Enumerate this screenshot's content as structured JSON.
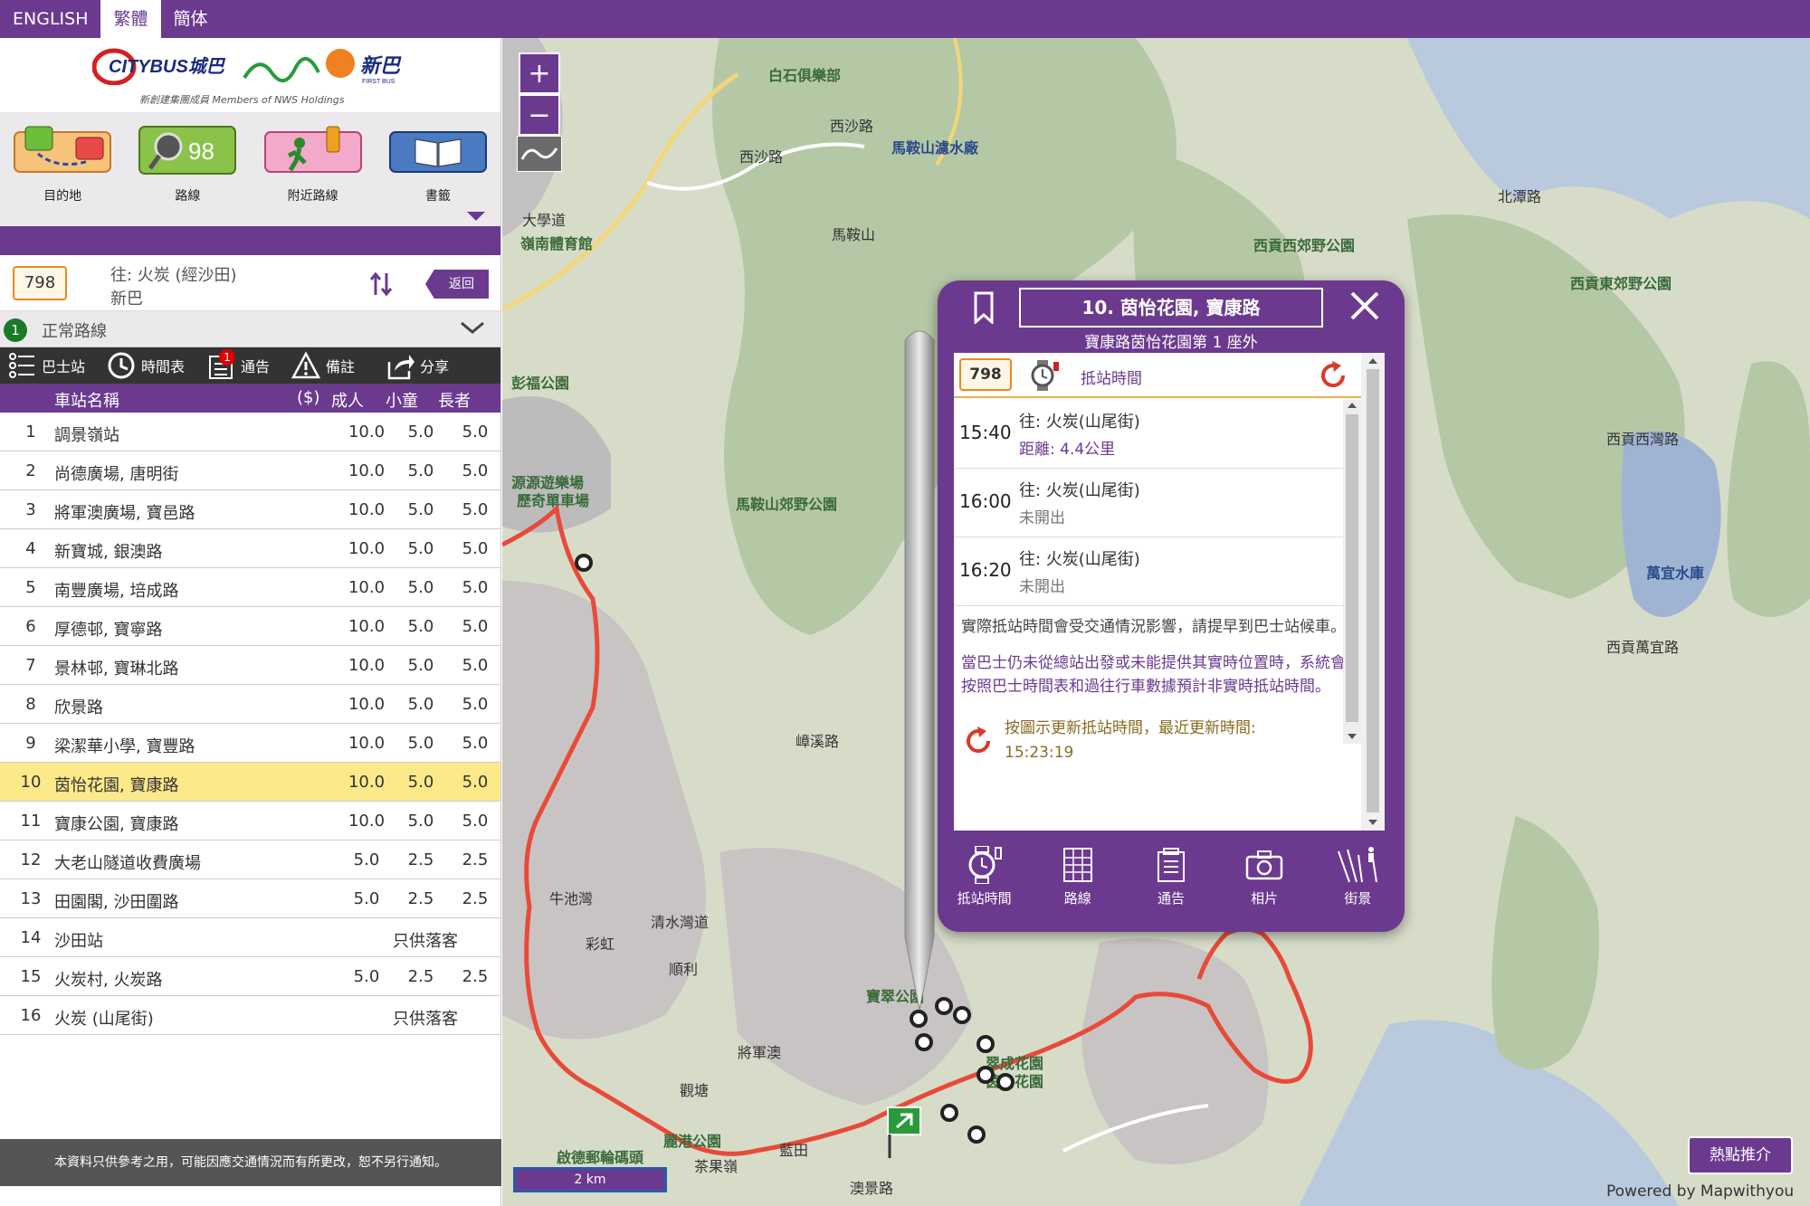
{
  "languages": [
    {
      "label": "ENGLISH",
      "active": false
    },
    {
      "label": "繁體",
      "active": true
    },
    {
      "label": "簡体",
      "active": false
    }
  ],
  "logo": {
    "citybus": "CITYBUS城巴",
    "nwfb": "新巴",
    "nwfb_sub": "FIRST BUS",
    "members": "新創建集團成員 Members of NWS Holdings"
  },
  "nav": [
    {
      "label": "目的地",
      "icon": "from-to-icon"
    },
    {
      "label": "路線",
      "icon": "route-search-icon",
      "icon_text": "98"
    },
    {
      "label": "附近路線",
      "icon": "nearby-walker-icon"
    },
    {
      "label": "書籤",
      "icon": "bookmark-book-icon"
    }
  ],
  "route": {
    "number": "798",
    "destination": "往: 火炭 (經沙田)",
    "operator": "新巴",
    "back_label": "返回",
    "variant_number": "1",
    "variant_label": "正常路線"
  },
  "tabs": [
    {
      "label": "巴士站",
      "icon": "list-icon"
    },
    {
      "label": "時間表",
      "icon": "clock-icon"
    },
    {
      "label": "通告",
      "icon": "notice-icon",
      "badge": "1"
    },
    {
      "label": "備註",
      "icon": "warning-icon"
    },
    {
      "label": "分享",
      "icon": "share-icon"
    }
  ],
  "table_head": {
    "name": "車站名稱",
    "currency": "($)",
    "adult": "成人",
    "child": "小童",
    "senior": "長者"
  },
  "stops": [
    {
      "idx": "1",
      "name": "調景嶺站",
      "adult": "10.0",
      "child": "5.0",
      "senior": "5.0"
    },
    {
      "idx": "2",
      "name": "尚德廣場, 唐明街",
      "adult": "10.0",
      "child": "5.0",
      "senior": "5.0"
    },
    {
      "idx": "3",
      "name": "將軍澳廣場, 寶邑路",
      "adult": "10.0",
      "child": "5.0",
      "senior": "5.0"
    },
    {
      "idx": "4",
      "name": "新寶城, 銀澳路",
      "adult": "10.0",
      "child": "5.0",
      "senior": "5.0"
    },
    {
      "idx": "5",
      "name": "南豐廣場, 培成路",
      "adult": "10.0",
      "child": "5.0",
      "senior": "5.0"
    },
    {
      "idx": "6",
      "name": "厚德邨, 寶寧路",
      "adult": "10.0",
      "child": "5.0",
      "senior": "5.0"
    },
    {
      "idx": "7",
      "name": "景林邨, 寶琳北路",
      "adult": "10.0",
      "child": "5.0",
      "senior": "5.0"
    },
    {
      "idx": "8",
      "name": "欣景路",
      "adult": "10.0",
      "child": "5.0",
      "senior": "5.0"
    },
    {
      "idx": "9",
      "name": "梁潔華小學, 寶豐路",
      "adult": "10.0",
      "child": "5.0",
      "senior": "5.0"
    },
    {
      "idx": "10",
      "name": "茵怡花園, 寶康路",
      "adult": "10.0",
      "child": "5.0",
      "senior": "5.0",
      "highlight": true
    },
    {
      "idx": "11",
      "name": "寶康公園, 寶康路",
      "adult": "10.0",
      "child": "5.0",
      "senior": "5.0"
    },
    {
      "idx": "12",
      "name": "大老山隧道收費廣場",
      "adult": "5.0",
      "child": "2.5",
      "senior": "2.5"
    },
    {
      "idx": "13",
      "name": "田園閣, 沙田圍路",
      "adult": "5.0",
      "child": "2.5",
      "senior": "2.5"
    },
    {
      "idx": "14",
      "name": "沙田站",
      "dropoff": "只供落客"
    },
    {
      "idx": "15",
      "name": "火炭村, 火炭路",
      "adult": "5.0",
      "child": "2.5",
      "senior": "2.5"
    },
    {
      "idx": "16",
      "name": "火炭 (山尾街)",
      "dropoff": "只供落客"
    }
  ],
  "footer_note": "本資料只供參考之用，可能因應交通情況而有所更改，恕不另行通知。",
  "map": {
    "zoom_in": "+",
    "zoom_out": "−",
    "scale": "2 km",
    "hot_button": "熱點推介",
    "powered_by": "Powered by Mapwithyou",
    "labels": [
      {
        "text": "白石俱樂部",
        "style": "green"
      },
      {
        "text": "西沙路",
        "style": "road"
      },
      {
        "text": "馬鞍山濾水廠",
        "style": "blue"
      },
      {
        "text": "西沙路",
        "style": "road"
      },
      {
        "text": "馬鞍山",
        "style": "road"
      },
      {
        "text": "大學道",
        "style": "road"
      },
      {
        "text": "嶺南體育館",
        "style": "green"
      },
      {
        "text": "西貢西郊野公園",
        "style": "green"
      },
      {
        "text": "西貢東郊野公園",
        "style": "green"
      },
      {
        "text": "北潭路",
        "style": "road"
      },
      {
        "text": "西貢西灣路",
        "style": "road"
      },
      {
        "text": "萬宜水庫",
        "style": "blue"
      },
      {
        "text": "西貢萬宜路",
        "style": "road"
      },
      {
        "text": "馬鞍山郊野公園",
        "style": "green"
      },
      {
        "text": "源源遊樂場",
        "style": "green"
      },
      {
        "text": "歷奇單車場",
        "style": "green"
      },
      {
        "text": "彭福公園",
        "style": "green"
      },
      {
        "text": "嶂溪路",
        "style": "road"
      },
      {
        "text": "牛池灣",
        "style": "road"
      },
      {
        "text": "清水灣道",
        "style": "road"
      },
      {
        "text": "彩虹",
        "style": "road"
      },
      {
        "text": "順利",
        "style": "road"
      },
      {
        "text": "藍田",
        "style": "road"
      },
      {
        "text": "茶果嶺",
        "style": "road"
      },
      {
        "text": "觀塘",
        "style": "road"
      },
      {
        "text": "啟德郵輪碼頭",
        "style": "green"
      },
      {
        "text": "麗港公園",
        "style": "green"
      },
      {
        "text": "寶翠公園",
        "style": "green"
      },
      {
        "text": "澳景路",
        "style": "road"
      },
      {
        "text": "將軍澳",
        "style": "road"
      },
      {
        "text": "翠成花園",
        "style": "green"
      },
      {
        "text": "茵怡花園",
        "style": "green"
      }
    ]
  },
  "popup": {
    "title": "10. 茵怡花園, 寶康路",
    "subtitle": "寶康路茵怡花園第 1 座外",
    "route_number": "798",
    "eta_title": "抵站時間",
    "etas": [
      {
        "time": "15:40",
        "dest": "往: 火炭(山尾街)",
        "status": "距離: 4.4公里",
        "is_distance": true
      },
      {
        "time": "16:00",
        "dest": "往: 火炭(山尾街)",
        "status": "未開出",
        "is_distance": false
      },
      {
        "time": "16:20",
        "dest": "往: 火炭(山尾街)",
        "status": "未開出",
        "is_distance": false
      }
    ],
    "note1": "實際抵站時間會受交通情況影響，請提早到巴士站候車。",
    "note2": "當巴士仍未從總站出發或未能提供其實時位置時，系統會按照巴士時間表和過往行車數據預計非實時抵站時間。",
    "update_line1": "按圖示更新抵站時間，最近更新時間:",
    "update_time": "15:23:19",
    "actions": [
      {
        "label": "抵站時間",
        "icon": "eta-watch-icon"
      },
      {
        "label": "路線",
        "icon": "route-grid-icon"
      },
      {
        "label": "通告",
        "icon": "notice-icon"
      },
      {
        "label": "相片",
        "icon": "camera-icon"
      },
      {
        "label": "街景",
        "icon": "streetview-icon"
      }
    ]
  },
  "colors": {
    "brand_purple": "#6b3a8f",
    "highlight_yellow": "#fce98a",
    "route_red": "#e84a3a",
    "badge_orange": "#e88a1a"
  }
}
